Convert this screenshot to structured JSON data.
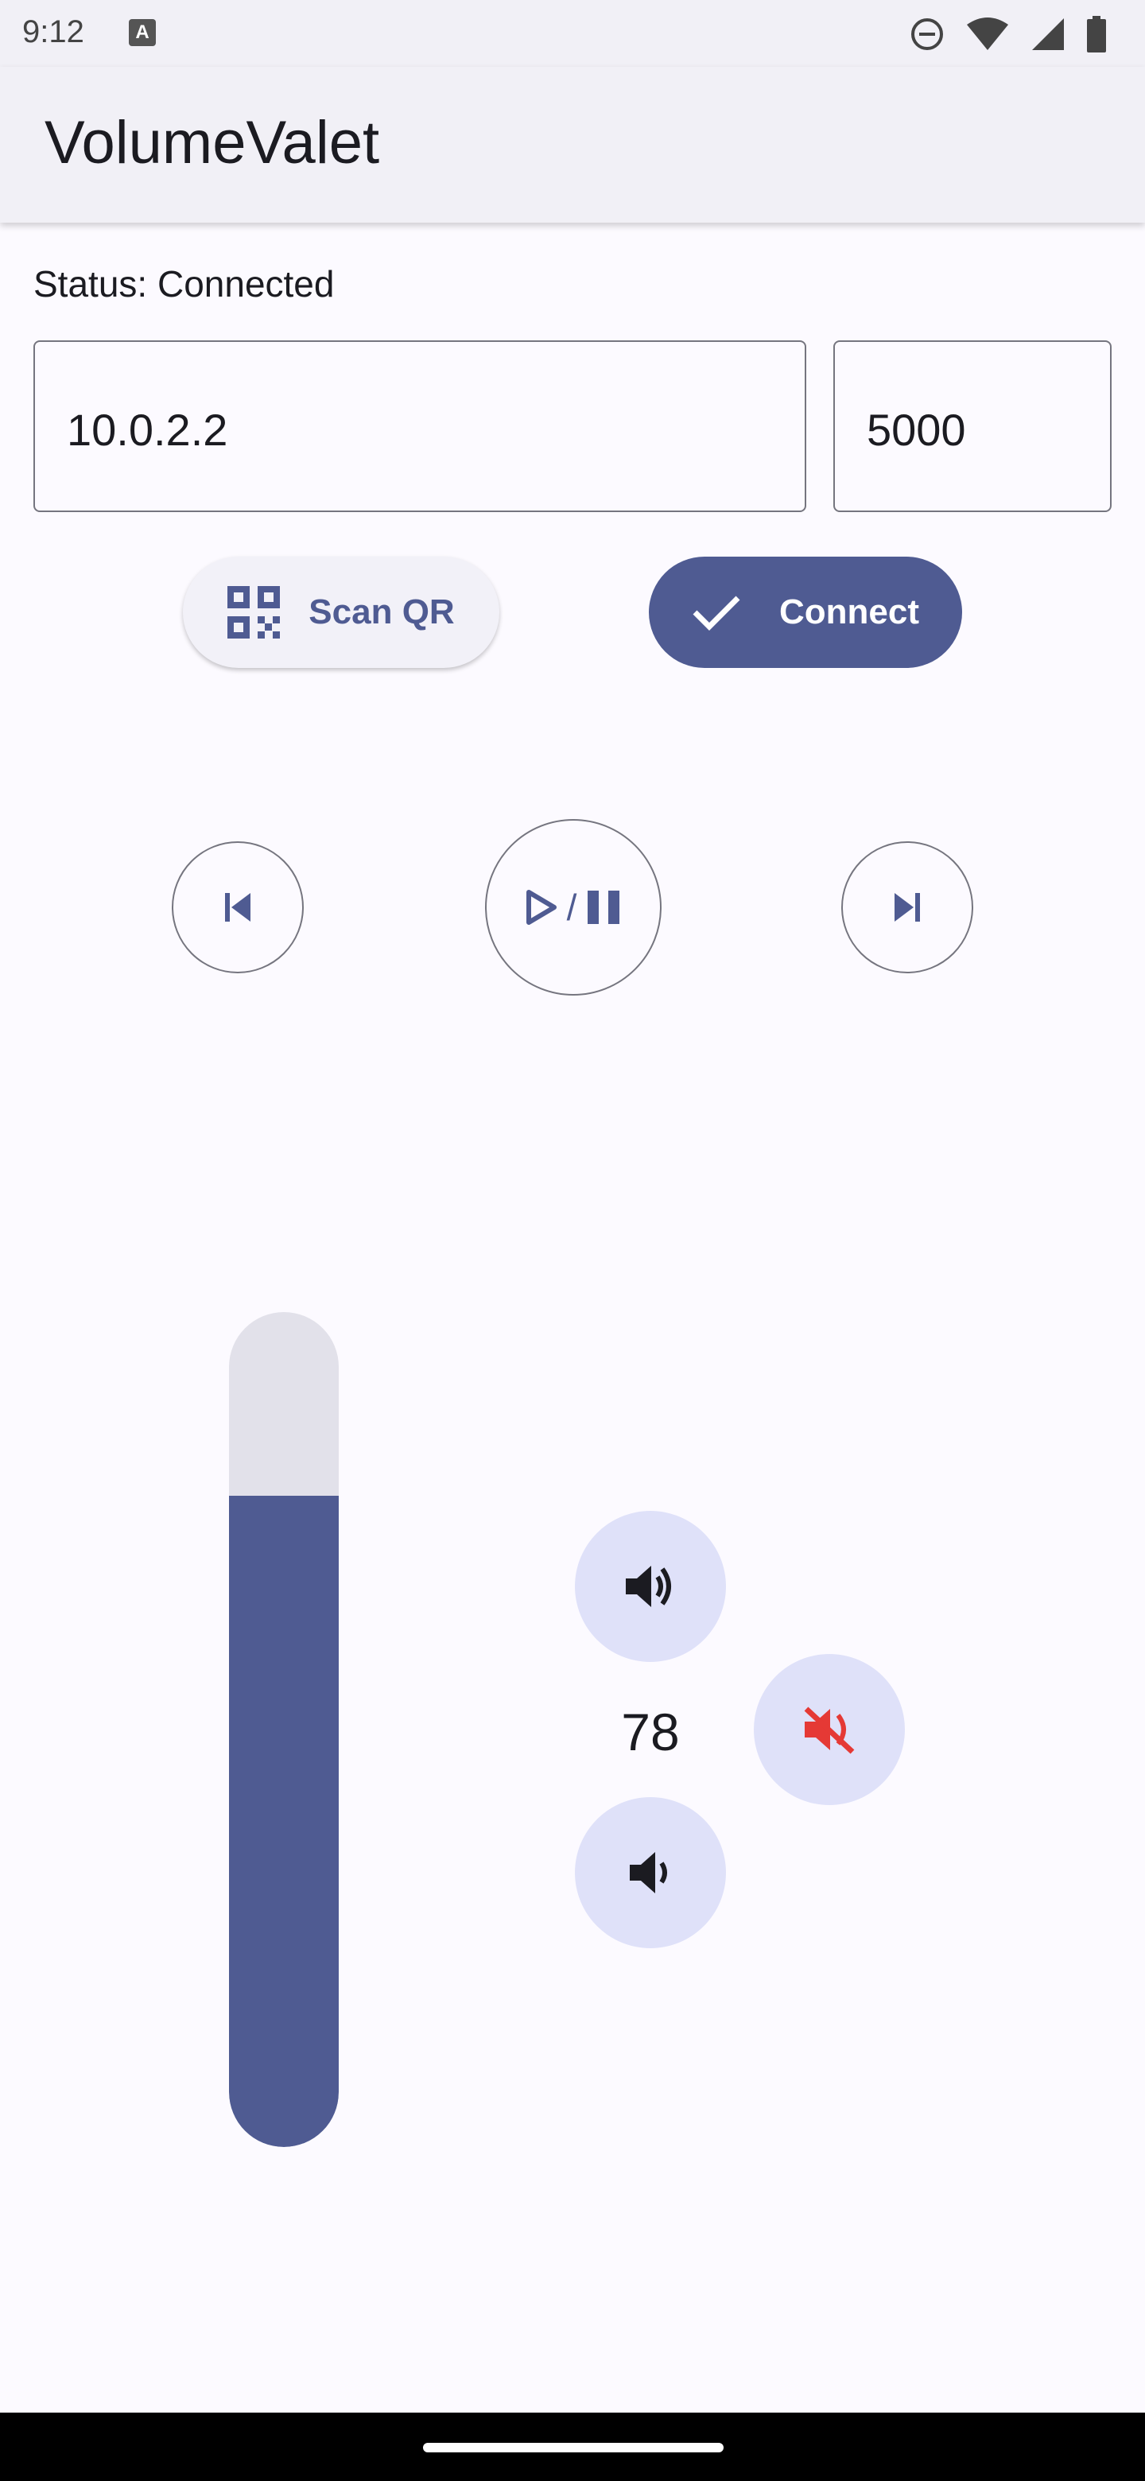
{
  "status_bar": {
    "time": "9:12"
  },
  "app": {
    "title": "VolumeValet"
  },
  "connection": {
    "status_text": "Status: Connected",
    "host_value": "10.0.2.2",
    "port_value": "5000",
    "scan_label": "Scan QR",
    "connect_label": "Connect"
  },
  "media": {
    "separator": "/"
  },
  "volume": {
    "level": 78,
    "level_text": "78",
    "max": 100
  },
  "colors": {
    "primary": "#4f5b92",
    "tonal": "#dfe1f9",
    "track": "#e2e1ea",
    "mute_red": "#e53935",
    "background": "#fcfaff"
  },
  "icons": {
    "status": [
      "keyboard-a-icon",
      "do-not-disturb-icon",
      "wifi-icon",
      "signal-icon",
      "battery-icon"
    ],
    "controls": [
      "skip-previous-icon",
      "play-icon",
      "pause-icon",
      "skip-next-icon",
      "volume-up-icon",
      "volume-down-icon",
      "volume-off-icon",
      "qr-code-icon",
      "check-icon"
    ]
  }
}
